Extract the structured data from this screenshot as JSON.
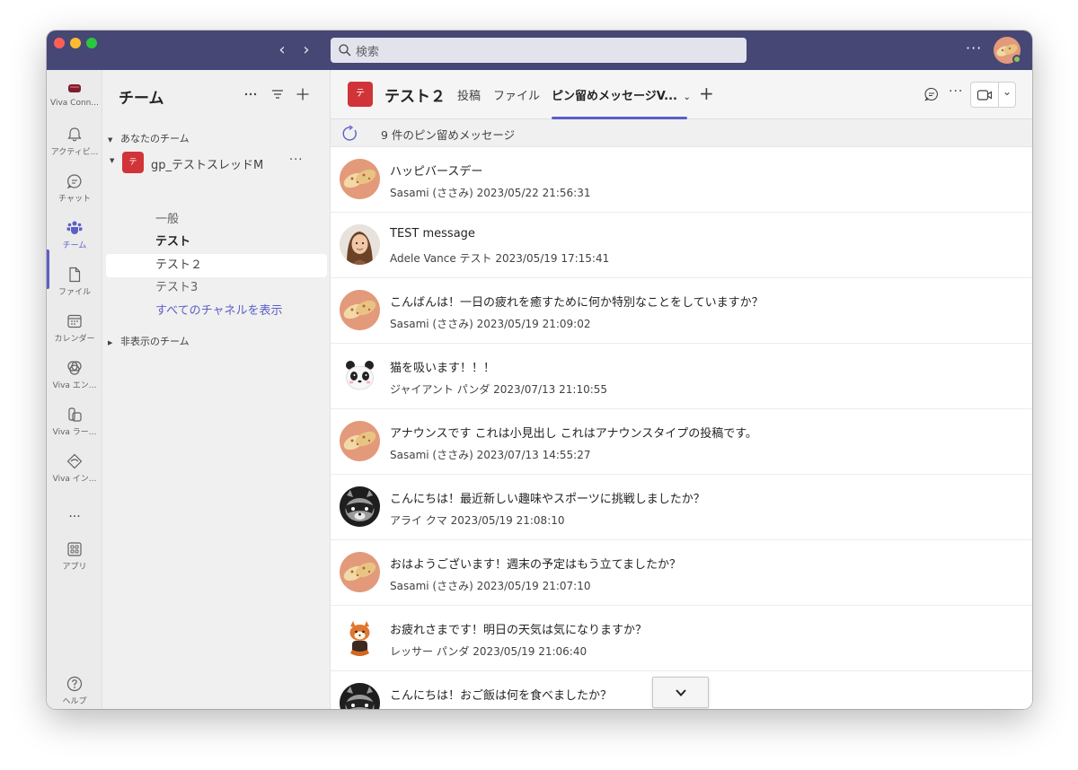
{
  "titlebar": {
    "search_placeholder": "検索",
    "back_icon": "chevron-left-icon",
    "forward_icon": "chevron-right-icon",
    "more": "···"
  },
  "rail": {
    "items": [
      {
        "label": "Viva Conn...",
        "icon": "viva-connections-icon"
      },
      {
        "label": "アクティビ...",
        "icon": "bell-icon"
      },
      {
        "label": "チャット",
        "icon": "chat-icon"
      },
      {
        "label": "チーム",
        "icon": "teams-icon",
        "active": true
      },
      {
        "label": "ファイル",
        "icon": "file-icon"
      },
      {
        "label": "カレンダー",
        "icon": "calendar-icon"
      },
      {
        "label": "Viva エン...",
        "icon": "viva-engage-icon"
      },
      {
        "label": "Viva ラー...",
        "icon": "viva-learning-icon"
      },
      {
        "label": "Viva イン...",
        "icon": "viva-insights-icon"
      },
      {
        "label": "···",
        "icon": "more-apps-icon"
      },
      {
        "label": "アプリ",
        "icon": "apps-icon"
      },
      {
        "label": "ヘルプ",
        "icon": "help-icon"
      }
    ]
  },
  "teams_pane": {
    "title": "チーム",
    "your_teams_label": "あなたのチーム",
    "team": {
      "name": "gp_テストスレッドM",
      "avatar_text": "テ",
      "more": "···"
    },
    "channels": [
      "一般",
      "テスト",
      "テスト２",
      "テスト3"
    ],
    "show_all_label": "すべてのチャネルを表示",
    "hidden_teams_label": "非表示のチーム"
  },
  "channel_header": {
    "avatar_text": "テ",
    "title": "テスト２",
    "tabs": [
      "投稿",
      "ファイル",
      "ピン留めメッセージV..."
    ],
    "active_tab": 2,
    "add_tab": "+",
    "more": "···"
  },
  "pinned": {
    "count_label": "9 件のピン留めメッセージ",
    "messages": [
      {
        "text": "ハッピバースデー",
        "meta": "Sasami (ささみ) 2023/05/22 21:56:31",
        "avatar": "sasami"
      },
      {
        "text": "TEST message",
        "meta": "Adele Vance テスト 2023/05/19 17:15:41",
        "avatar": "adele"
      },
      {
        "text": "こんばんは！一日の疲れを癒すために何か特別なことをしていますか？",
        "meta": "Sasami (ささみ) 2023/05/19 21:09:02",
        "avatar": "sasami"
      },
      {
        "text": "猫を吸います！！！",
        "meta": "ジャイアント パンダ 2023/07/13 21:10:55",
        "avatar": "panda"
      },
      {
        "text": "アナウンスです これは小見出し これはアナウンスタイプの投稿です。",
        "meta": "Sasami (ささみ) 2023/07/13 14:55:27",
        "avatar": "sasami"
      },
      {
        "text": "こんにちは！最近新しい趣味やスポーツに挑戦しましたか？",
        "meta": "アライ クマ 2023/05/19 21:08:10",
        "avatar": "raccoon"
      },
      {
        "text": "おはようございます！週末の予定はもう立てましたか？",
        "meta": "Sasami (ささみ) 2023/05/19 21:07:10",
        "avatar": "sasami"
      },
      {
        "text": "お疲れさまです！明日の天気は気になりますか？",
        "meta": "レッサー パンダ 2023/05/19 21:06:40",
        "avatar": "redpanda"
      },
      {
        "text": "こんにちは！おご飯は何を食べましたか？",
        "meta": "",
        "avatar": "raccoon"
      }
    ]
  },
  "colors": {
    "titlebar": "#464775",
    "accent": "#5b5fc7",
    "team_avatar": "#d13438"
  }
}
